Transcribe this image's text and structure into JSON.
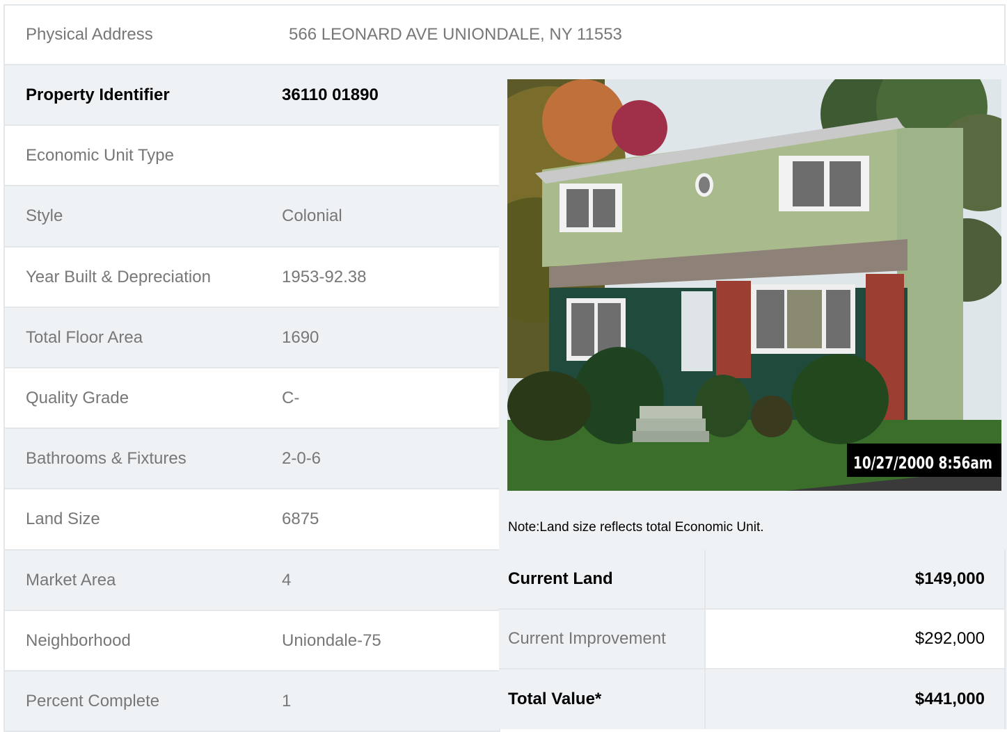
{
  "address": {
    "label": "Physical Address",
    "value": "566  LEONARD AVE  UNIONDALE, NY  11553"
  },
  "rows": [
    {
      "label": "Property Identifier",
      "value": "36110  01890"
    },
    {
      "label": "Economic Unit Type",
      "value": ""
    },
    {
      "label": "Style",
      "value": "Colonial"
    },
    {
      "label": "Year Built & Depreciation",
      "value": "1953-92.38"
    },
    {
      "label": "Total Floor Area",
      "value": "1690"
    },
    {
      "label": "Quality Grade",
      "value": "C-"
    },
    {
      "label": "Bathrooms & Fixtures",
      "value": "2-0-6"
    },
    {
      "label": "Land Size",
      "value": "6875"
    },
    {
      "label": "Market Area",
      "value": "4"
    },
    {
      "label": "Neighborhood",
      "value": "Uniondale-75"
    },
    {
      "label": "Percent Complete",
      "value": "1"
    }
  ],
  "photo": {
    "timestamp": "10/27/2000 8:56am"
  },
  "note": "Note:Land size reflects total Economic Unit.",
  "values": [
    {
      "label": "Current Land",
      "value": "$149,000"
    },
    {
      "label": "Current Improvement",
      "value": "$292,000"
    },
    {
      "label": "Total Value*",
      "value": "$441,000"
    }
  ],
  "colors": {
    "shade": "#eff2f5",
    "border": "#e4e7ea",
    "text": "#777777"
  }
}
